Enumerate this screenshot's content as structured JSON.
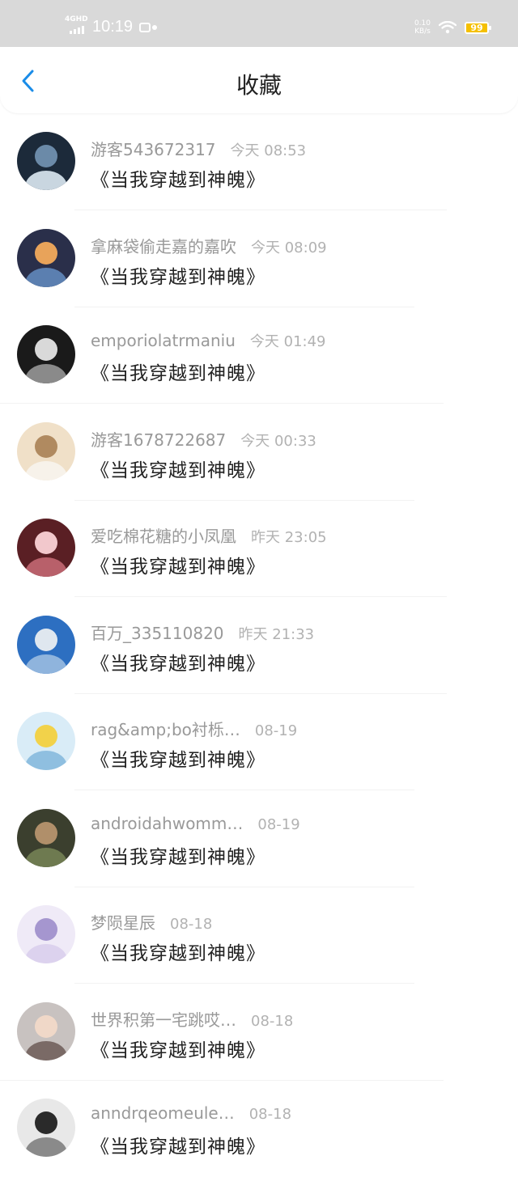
{
  "status_bar": {
    "network": "4GHD",
    "time": "10:19",
    "speed_value": "0.10",
    "speed_unit": "KB/s",
    "battery": "99"
  },
  "nav": {
    "title": "收藏"
  },
  "icons": {
    "back": "chevron-left-icon"
  },
  "colors": {
    "accent": "#1a8ce8",
    "status_bar_bg": "#d9d9d9",
    "battery": "#f5c000",
    "username": "#999999",
    "time": "#b2b2b2"
  },
  "items": [
    {
      "username": "游客543672317",
      "time": "今天 08:53",
      "title": "《当我穿越到神魄》"
    },
    {
      "username": "拿麻袋偷走嘉的嘉吹",
      "time": "今天 08:09",
      "title": "《当我穿越到神魄》"
    },
    {
      "username": "emporiolatrmaniu",
      "time": "今天 01:49",
      "title": "《当我穿越到神魄》"
    },
    {
      "username": "游客1678722687",
      "time": "今天 00:33",
      "title": "《当我穿越到神魄》"
    },
    {
      "username": "爱吃棉花糖的小凤凰",
      "time": "昨天 23:05",
      "title": "《当我穿越到神魄》"
    },
    {
      "username": "百万_335110820",
      "time": "昨天 21:33",
      "title": "《当我穿越到神魄》"
    },
    {
      "username": "rag&amp;bo衬栎…",
      "time": "08-19",
      "title": "《当我穿越到神魄》"
    },
    {
      "username": "androidahwomm…",
      "time": "08-19",
      "title": "《当我穿越到神魄》"
    },
    {
      "username": "梦陨星辰",
      "time": "08-18",
      "title": "《当我穿越到神魄》"
    },
    {
      "username": "世界积第一宅跳哎…",
      "time": "08-18",
      "title": "《当我穿越到神魄》"
    },
    {
      "username": "anndrqeomeule…",
      "time": "08-18",
      "title": "《当我穿越到神魄》"
    }
  ]
}
